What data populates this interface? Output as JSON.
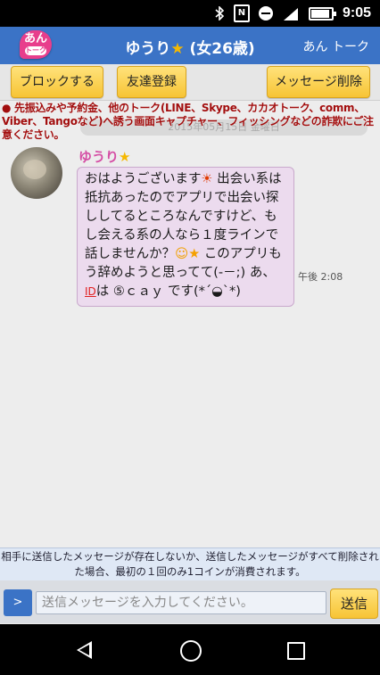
{
  "status_bar": {
    "time": "9:05",
    "network": "4G",
    "battery_level": 0.9,
    "icons": [
      "bluetooth-icon",
      "nfc-icon",
      "do-not-disturb-icon",
      "signal-icon",
      "battery-icon"
    ]
  },
  "header": {
    "logo_line1": "あん",
    "logo_line2": "トーク",
    "title": "ゆうり",
    "title_star": "★",
    "title_suffix": " (女26歳)",
    "right_label": "あん トーク",
    "color": "#3b73c6"
  },
  "toolbar": {
    "block_label": "ブロックする",
    "friend_label": "友達登録",
    "delete_label": "メッセージ削除"
  },
  "warning": {
    "date_text": "2015年05月15日 金曜日",
    "text": "● 先振込みや予約金、他のトーク(LINE、Skype、カカオトーク、comm、Viber、Tangoなど)へ誘う画面キャプチャー、フィッシングなどの詐欺にご注意ください。"
  },
  "message": {
    "sender": "ゆうり",
    "sender_star": "★",
    "part1": "おはようございます",
    "part2": "出会い系は抵抗あったのでアプリで出会い探ししてるところなんですけど、もし会える系の人なら１度ラインで話しませんか？",
    "part3": "このアプリもう辞めようと思ってて(-－;) あ、",
    "id_mark": "ID",
    "part4": "は ⑤ｃａｙ です(*´◒`*)",
    "time": "午後 2:08",
    "emoji_sun": "☀",
    "emoji_face": "☺",
    "emoji_star": "★"
  },
  "notice": {
    "text": "相手に送信したメッセージが存在しないか、送信したメッセージがすべて削除された場合、最初の１回のみ1コインが消費されます。"
  },
  "input": {
    "expand_label": ">",
    "placeholder": "送信メッセージを入力してください。",
    "send_label": "送信"
  }
}
